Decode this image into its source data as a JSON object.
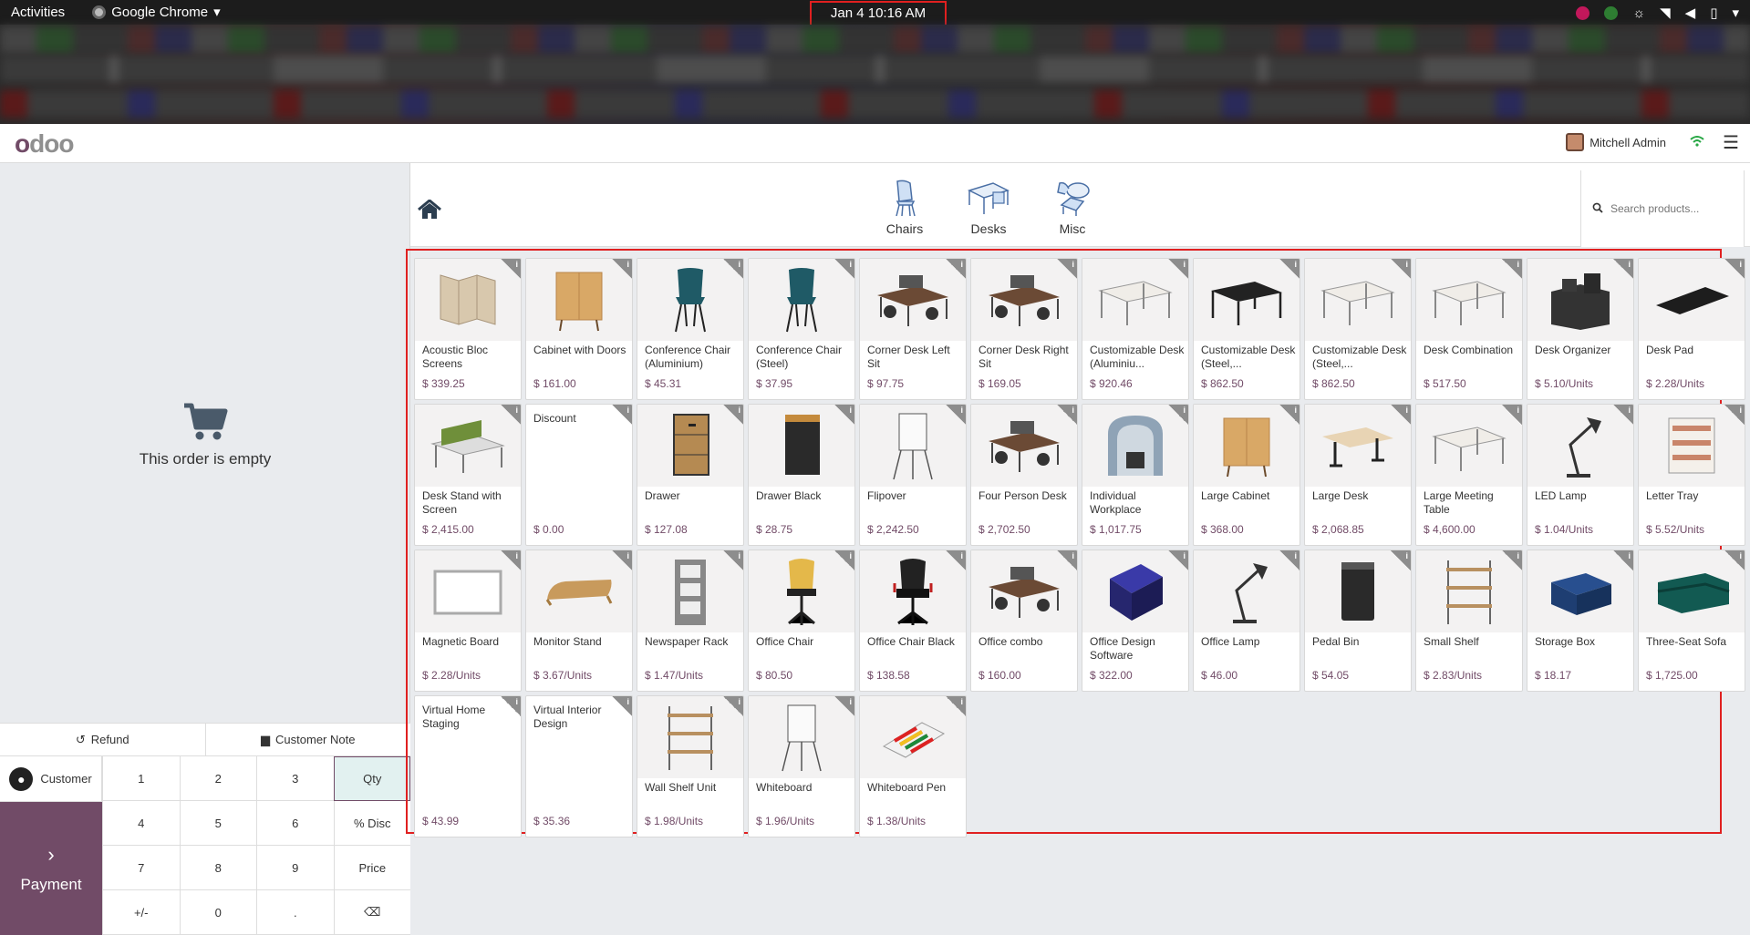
{
  "topbar": {
    "activities": "Activities",
    "app_name": "Google Chrome",
    "clock": "Jan 4  10:16 AM"
  },
  "header": {
    "logo": "odoo",
    "user_name": "Mitchell Admin"
  },
  "order": {
    "empty_text": "This order is empty"
  },
  "controls": {
    "refund": "Refund",
    "customer_note": "Customer Note",
    "customer": "Customer",
    "payment": "Payment"
  },
  "numpad": {
    "keys": [
      "1",
      "2",
      "3",
      "Qty",
      "4",
      "5",
      "6",
      "% Disc",
      "7",
      "8",
      "9",
      "Price",
      "+/-",
      "0",
      ".",
      "⌫"
    ],
    "active": "Qty"
  },
  "categories": [
    {
      "label": "Chairs",
      "icon": "chair-icon"
    },
    {
      "label": "Desks",
      "icon": "desk-icon"
    },
    {
      "label": "Misc",
      "icon": "misc-icon"
    }
  ],
  "search": {
    "placeholder": "Search products..."
  },
  "products": [
    {
      "name": "Acoustic Bloc Screens",
      "price": "$ 339.25",
      "img": "screen"
    },
    {
      "name": "Cabinet with Doors",
      "price": "$ 161.00",
      "img": "cabinet"
    },
    {
      "name": "Conference Chair (Aluminium)",
      "price": "$ 45.31",
      "img": "chair"
    },
    {
      "name": "Conference Chair (Steel)",
      "price": "$ 37.95",
      "img": "chair"
    },
    {
      "name": "Corner Desk Left Sit",
      "price": "$ 97.75",
      "img": "workdesk"
    },
    {
      "name": "Corner Desk Right Sit",
      "price": "$ 169.05",
      "img": "workdesk"
    },
    {
      "name": "Customizable Desk (Aluminiu...",
      "price": "$ 920.46",
      "img": "tablewhite"
    },
    {
      "name": "Customizable Desk (Steel,...",
      "price": "$ 862.50",
      "img": "tableblack"
    },
    {
      "name": "Customizable Desk (Steel,...",
      "price": "$ 862.50",
      "img": "tablewhite"
    },
    {
      "name": "Desk Combination",
      "price": "$ 517.50",
      "img": "tablewhite"
    },
    {
      "name": "Desk Organizer",
      "price": "$ 5.10/Units",
      "img": "organizer"
    },
    {
      "name": "Desk Pad",
      "price": "$ 2.28/Units",
      "img": "pad"
    },
    {
      "name": "Desk Stand with Screen",
      "price": "$ 2,415.00",
      "img": "standscreen"
    },
    {
      "name": "Discount",
      "price": "$ 0.00",
      "img": ""
    },
    {
      "name": "Drawer",
      "price": "$ 127.08",
      "img": "drawer"
    },
    {
      "name": "Drawer Black",
      "price": "$ 28.75",
      "img": "drawerblack"
    },
    {
      "name": "Flipover",
      "price": "$ 2,242.50",
      "img": "flipover"
    },
    {
      "name": "Four Person Desk",
      "price": "$ 2,702.50",
      "img": "workdesk"
    },
    {
      "name": "Individual Workplace",
      "price": "$ 1,017.75",
      "img": "booth"
    },
    {
      "name": "Large Cabinet",
      "price": "$ 368.00",
      "img": "cabinet"
    },
    {
      "name": "Large Desk",
      "price": "$ 2,068.85",
      "img": "tablewood"
    },
    {
      "name": "Large Meeting Table",
      "price": "$ 4,600.00",
      "img": "tablewhite"
    },
    {
      "name": "LED Lamp",
      "price": "$ 1.04/Units",
      "img": "lamp"
    },
    {
      "name": "Letter Tray",
      "price": "$ 5.52/Units",
      "img": "tray"
    },
    {
      "name": "Magnetic Board",
      "price": "$ 2.28/Units",
      "img": "board"
    },
    {
      "name": "Monitor Stand",
      "price": "$ 3.67/Units",
      "img": "monitorstand"
    },
    {
      "name": "Newspaper Rack",
      "price": "$ 1.47/Units",
      "img": "rack"
    },
    {
      "name": "Office Chair",
      "price": "$ 80.50",
      "img": "officechair"
    },
    {
      "name": "Office Chair Black",
      "price": "$ 138.58",
      "img": "officechairblack"
    },
    {
      "name": "Office combo",
      "price": "$ 160.00",
      "img": "workdesk"
    },
    {
      "name": "Office Design Software",
      "price": "$ 322.00",
      "img": "software"
    },
    {
      "name": "Office Lamp",
      "price": "$ 46.00",
      "img": "lamp"
    },
    {
      "name": "Pedal Bin",
      "price": "$ 54.05",
      "img": "bin"
    },
    {
      "name": "Small Shelf",
      "price": "$ 2.83/Units",
      "img": "shelf"
    },
    {
      "name": "Storage Box",
      "price": "$ 18.17",
      "img": "box"
    },
    {
      "name": "Three-Seat Sofa",
      "price": "$ 1,725.00",
      "img": "sofa"
    },
    {
      "name": "Virtual Home Staging",
      "price": "$ 43.99",
      "img": ""
    },
    {
      "name": "Virtual Interior Design",
      "price": "$ 35.36",
      "img": ""
    },
    {
      "name": "Wall Shelf Unit",
      "price": "$ 1.98/Units",
      "img": "shelf"
    },
    {
      "name": "Whiteboard",
      "price": "$ 1.96/Units",
      "img": "flipover"
    },
    {
      "name": "Whiteboard Pen",
      "price": "$ 1.38/Units",
      "img": "pens"
    }
  ]
}
